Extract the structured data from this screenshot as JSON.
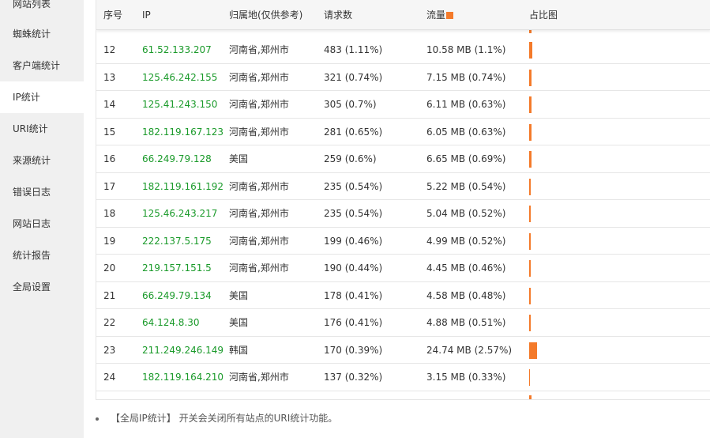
{
  "sidebar": {
    "items": [
      {
        "label": "网站列表",
        "name": "sidebar-item-site-list",
        "active": false
      },
      {
        "label": "蜘蛛统计",
        "name": "sidebar-item-spider-stats",
        "active": false
      },
      {
        "label": "客户端统计",
        "name": "sidebar-item-client-stats",
        "active": false
      },
      {
        "label": "IP统计",
        "name": "sidebar-item-ip-stats",
        "active": true
      },
      {
        "label": "URI统计",
        "name": "sidebar-item-uri-stats",
        "active": false
      },
      {
        "label": "来源统计",
        "name": "sidebar-item-referer-stats",
        "active": false
      },
      {
        "label": "错误日志",
        "name": "sidebar-item-error-log",
        "active": false
      },
      {
        "label": "网站日志",
        "name": "sidebar-item-site-log",
        "active": false
      },
      {
        "label": "统计报告",
        "name": "sidebar-item-report",
        "active": false
      },
      {
        "label": "全局设置",
        "name": "sidebar-item-global-settings",
        "active": false
      }
    ]
  },
  "table": {
    "headers": {
      "no": "序号",
      "ip": "IP",
      "location": "归属地(仅供参考)",
      "requests": "请求数",
      "traffic": "流量",
      "chart": "占比图"
    },
    "accent_color": "#f47a2a",
    "ip_color": "#1a9a2a",
    "rows": [
      {
        "no": "12",
        "ip": "61.52.133.207",
        "location": "河南省,郑州市",
        "requests": "483 (1.11%)",
        "traffic": "10.58 MB (1.1%)",
        "share": 0.011
      },
      {
        "no": "13",
        "ip": "125.46.242.155",
        "location": "河南省,郑州市",
        "requests": "321 (0.74%)",
        "traffic": "7.15 MB (0.74%)",
        "share": 0.0074
      },
      {
        "no": "14",
        "ip": "125.41.243.150",
        "location": "河南省,郑州市",
        "requests": "305 (0.7%)",
        "traffic": "6.11 MB (0.63%)",
        "share": 0.0063
      },
      {
        "no": "15",
        "ip": "182.119.167.123",
        "location": "河南省,郑州市",
        "requests": "281 (0.65%)",
        "traffic": "6.05 MB (0.63%)",
        "share": 0.0063
      },
      {
        "no": "16",
        "ip": "66.249.79.128",
        "location": "美国",
        "requests": "259 (0.6%)",
        "traffic": "6.65 MB (0.69%)",
        "share": 0.0069
      },
      {
        "no": "17",
        "ip": "182.119.161.192",
        "location": "河南省,郑州市",
        "requests": "235 (0.54%)",
        "traffic": "5.22 MB (0.54%)",
        "share": 0.0054
      },
      {
        "no": "18",
        "ip": "125.46.243.217",
        "location": "河南省,郑州市",
        "requests": "235 (0.54%)",
        "traffic": "5.04 MB (0.52%)",
        "share": 0.0052
      },
      {
        "no": "19",
        "ip": "222.137.5.175",
        "location": "河南省,郑州市",
        "requests": "199 (0.46%)",
        "traffic": "4.99 MB (0.52%)",
        "share": 0.0052
      },
      {
        "no": "20",
        "ip": "219.157.151.5",
        "location": "河南省,郑州市",
        "requests": "190 (0.44%)",
        "traffic": "4.45 MB (0.46%)",
        "share": 0.0046
      },
      {
        "no": "21",
        "ip": "66.249.79.134",
        "location": "美国",
        "requests": "178 (0.41%)",
        "traffic": "4.58 MB (0.48%)",
        "share": 0.0048
      },
      {
        "no": "22",
        "ip": "64.124.8.30",
        "location": "美国",
        "requests": "176 (0.41%)",
        "traffic": "4.88 MB (0.51%)",
        "share": 0.0051
      },
      {
        "no": "23",
        "ip": "211.249.246.149",
        "location": "韩国",
        "requests": "170 (0.39%)",
        "traffic": "24.74 MB (2.57%)",
        "share": 0.0257
      },
      {
        "no": "24",
        "ip": "182.119.164.210",
        "location": "河南省,郑州市",
        "requests": "137 (0.32%)",
        "traffic": "3.15 MB (0.33%)",
        "share": 0.0033
      }
    ]
  },
  "notes": [
    "【全局IP统计】 开关会关闭所有站点的URI统计功能。"
  ]
}
